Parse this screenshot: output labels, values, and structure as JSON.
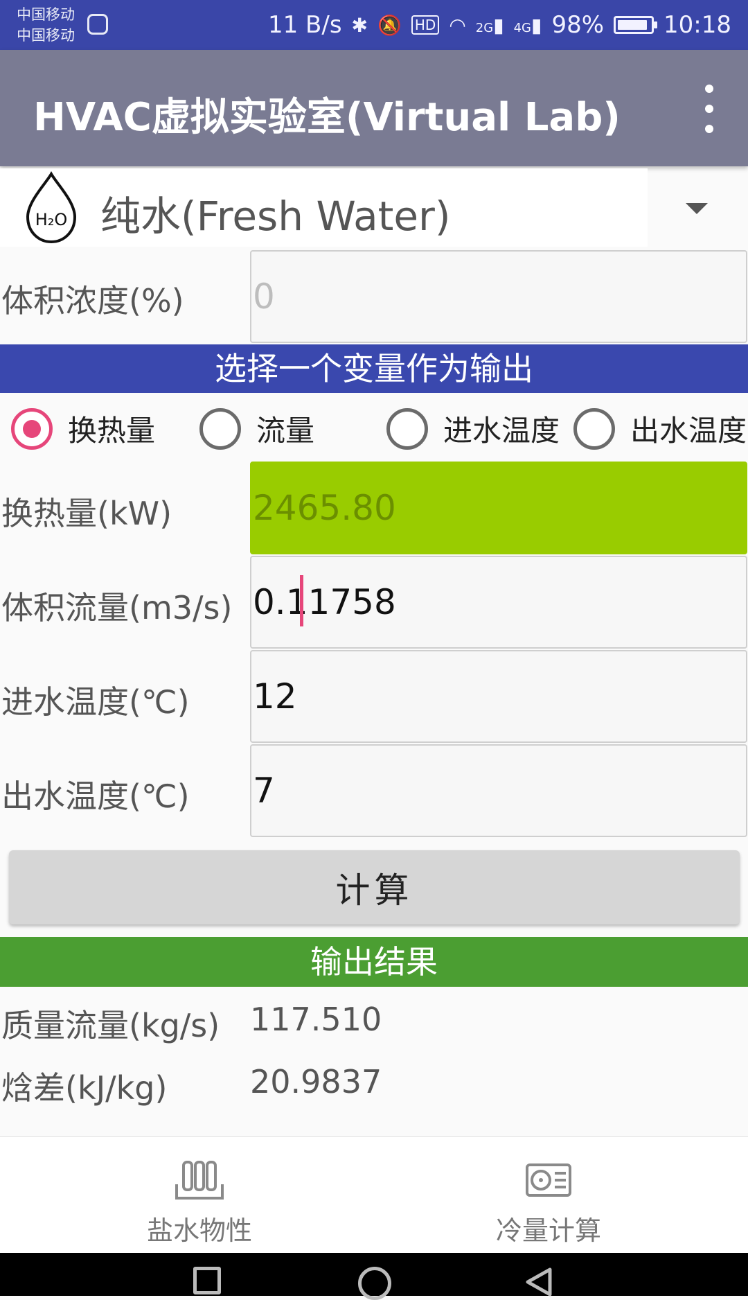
{
  "status_bar": {
    "carrier_1": "中国移动",
    "carrier_2": "中国移动",
    "net_speed": "11 B/s",
    "signal_2g": "2G",
    "signal_4g": "4G",
    "battery": "98%",
    "time": "10:18"
  },
  "app_bar": {
    "title": "HVAC虚拟实验室(Virtual Lab)"
  },
  "fluid": {
    "selected": "纯水(Fresh Water)",
    "icon_text": "H2O"
  },
  "concentration": {
    "label": "体积浓度(%)",
    "placeholder": "0"
  },
  "output_select": {
    "header": "选择一个变量作为输出",
    "options": [
      {
        "label": "换热量",
        "checked": true
      },
      {
        "label": "流量",
        "checked": false
      },
      {
        "label": "进水温度",
        "checked": false
      },
      {
        "label": "出水温度",
        "checked": false
      }
    ]
  },
  "fields": {
    "heat": {
      "label": "换热量(kW)",
      "value": "2465.80"
    },
    "flow": {
      "label": "体积流量(m3/s)",
      "value": "0.11758"
    },
    "inlet_temp": {
      "label": "进水温度(℃)",
      "value": "12"
    },
    "outlet_temp": {
      "label": "出水温度(℃)",
      "value": "7"
    }
  },
  "calc_button": {
    "label": "计算"
  },
  "results": {
    "header": "输出结果",
    "items": [
      {
        "label": "质量流量(kg/s)",
        "value": "117.510"
      },
      {
        "label": "焓差(kJ/kg)",
        "value": "20.9837"
      }
    ]
  },
  "bottom_nav": {
    "items": [
      {
        "label": "盐水物性",
        "icon": "test-tubes-icon"
      },
      {
        "label": "冷量计算",
        "icon": "fan-unit-icon"
      }
    ]
  },
  "colors": {
    "status_bar": "#3a46a8",
    "app_bar": "#7a7b93",
    "section_blue": "#3a48ae",
    "section_green": "#4b9e32",
    "highlight_output": "#99cc00",
    "radio_accent": "#e6467a"
  }
}
